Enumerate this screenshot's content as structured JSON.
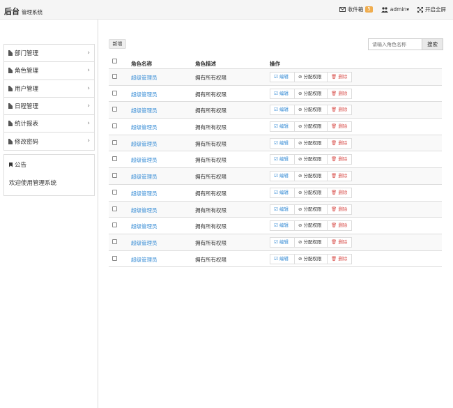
{
  "header": {
    "brand": "后台",
    "brand_sub": "管理系统",
    "inbox_label": "收件箱",
    "inbox_count": "5",
    "user_label": "admin▾",
    "fullscreen_label": "开启全屏"
  },
  "sidebar": {
    "items": [
      {
        "label": "部门管理"
      },
      {
        "label": "角色管理"
      },
      {
        "label": "用户管理"
      },
      {
        "label": "日程管理"
      },
      {
        "label": "统计报表"
      },
      {
        "label": "修改密码"
      }
    ],
    "notice_title": "公告",
    "notice_text": "欢迎使用管理系统"
  },
  "toolbar": {
    "add_label": "新增",
    "search_placeholder": "请输入角色名称",
    "search_label": "搜索"
  },
  "table": {
    "headers": {
      "name": "角色名称",
      "desc": "角色描述",
      "ops": "操作"
    },
    "op_labels": {
      "edit": "☑ 编辑",
      "assign": "⊘ 分配权限",
      "delete": "🗑 删除"
    },
    "rows": [
      {
        "name": "超级管理员",
        "desc": "拥有所有权限"
      },
      {
        "name": "超级管理员",
        "desc": "拥有所有权限"
      },
      {
        "name": "超级管理员",
        "desc": "拥有所有权限"
      },
      {
        "name": "超级管理员",
        "desc": "拥有所有权限"
      },
      {
        "name": "超级管理员",
        "desc": "拥有所有权限"
      },
      {
        "name": "超级管理员",
        "desc": "拥有所有权限"
      },
      {
        "name": "超级管理员",
        "desc": "拥有所有权限"
      },
      {
        "name": "超级管理员",
        "desc": "拥有所有权限"
      },
      {
        "name": "超级管理员",
        "desc": "拥有所有权限"
      },
      {
        "name": "超级管理员",
        "desc": "拥有所有权限"
      },
      {
        "name": "超级管理员",
        "desc": "拥有所有权限"
      },
      {
        "name": "超级管理员",
        "desc": "拥有所有权限"
      }
    ]
  },
  "colors": {
    "link": "#3a8ed6",
    "danger": "#d9534f",
    "badge": "#f0ad4e"
  }
}
